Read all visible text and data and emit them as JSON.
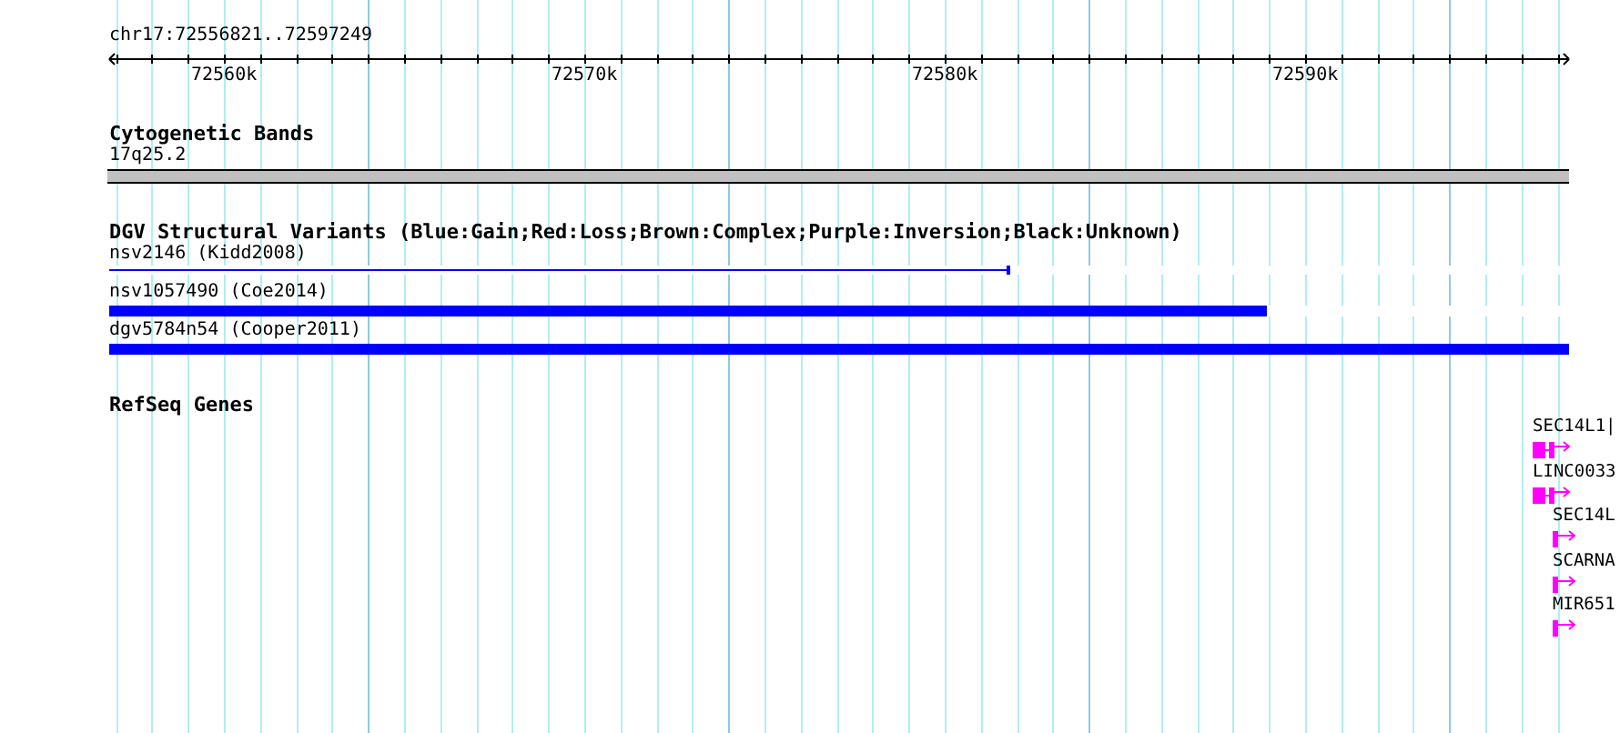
{
  "ruler": {
    "location": "chr17:72556821..72597249",
    "ticks": [
      "72560k",
      "72570k",
      "72580k",
      "72590k"
    ]
  },
  "cytogenetic_bands": {
    "title": "Cytogenetic Bands",
    "band": "17q25.2"
  },
  "dgv_structural_variants": {
    "title": "DGV Structural Variants (Blue:Gain;Red:Loss;Brown:Complex;Purple:Inversion;Black:Unknown)",
    "features": [
      {
        "name": "nsv2146",
        "source": "(Kidd2008)",
        "kind": "thin",
        "color": "#0000ff",
        "level": 0.617
      },
      {
        "name": "nsv1057490",
        "source": "(Coe2014)",
        "kind": "thick",
        "color": "#0000ff",
        "level": 0.793
      },
      {
        "name": "dgv5784n54",
        "source": "(Cooper2011)",
        "kind": "thick",
        "color": "#0000ff",
        "level": 1.0
      }
    ]
  },
  "refseq_genes": {
    "title": "RefSeq Genes",
    "genes": [
      {
        "name": "SEC14L1|",
        "kind": "multi-exon"
      },
      {
        "name": "LINC0033",
        "kind": "multi-exon"
      },
      {
        "name": "SEC14L",
        "kind": "single-exon"
      },
      {
        "name": "SCARNA",
        "kind": "single-exon"
      },
      {
        "name": "MIR651",
        "kind": "single-exon"
      }
    ]
  }
}
